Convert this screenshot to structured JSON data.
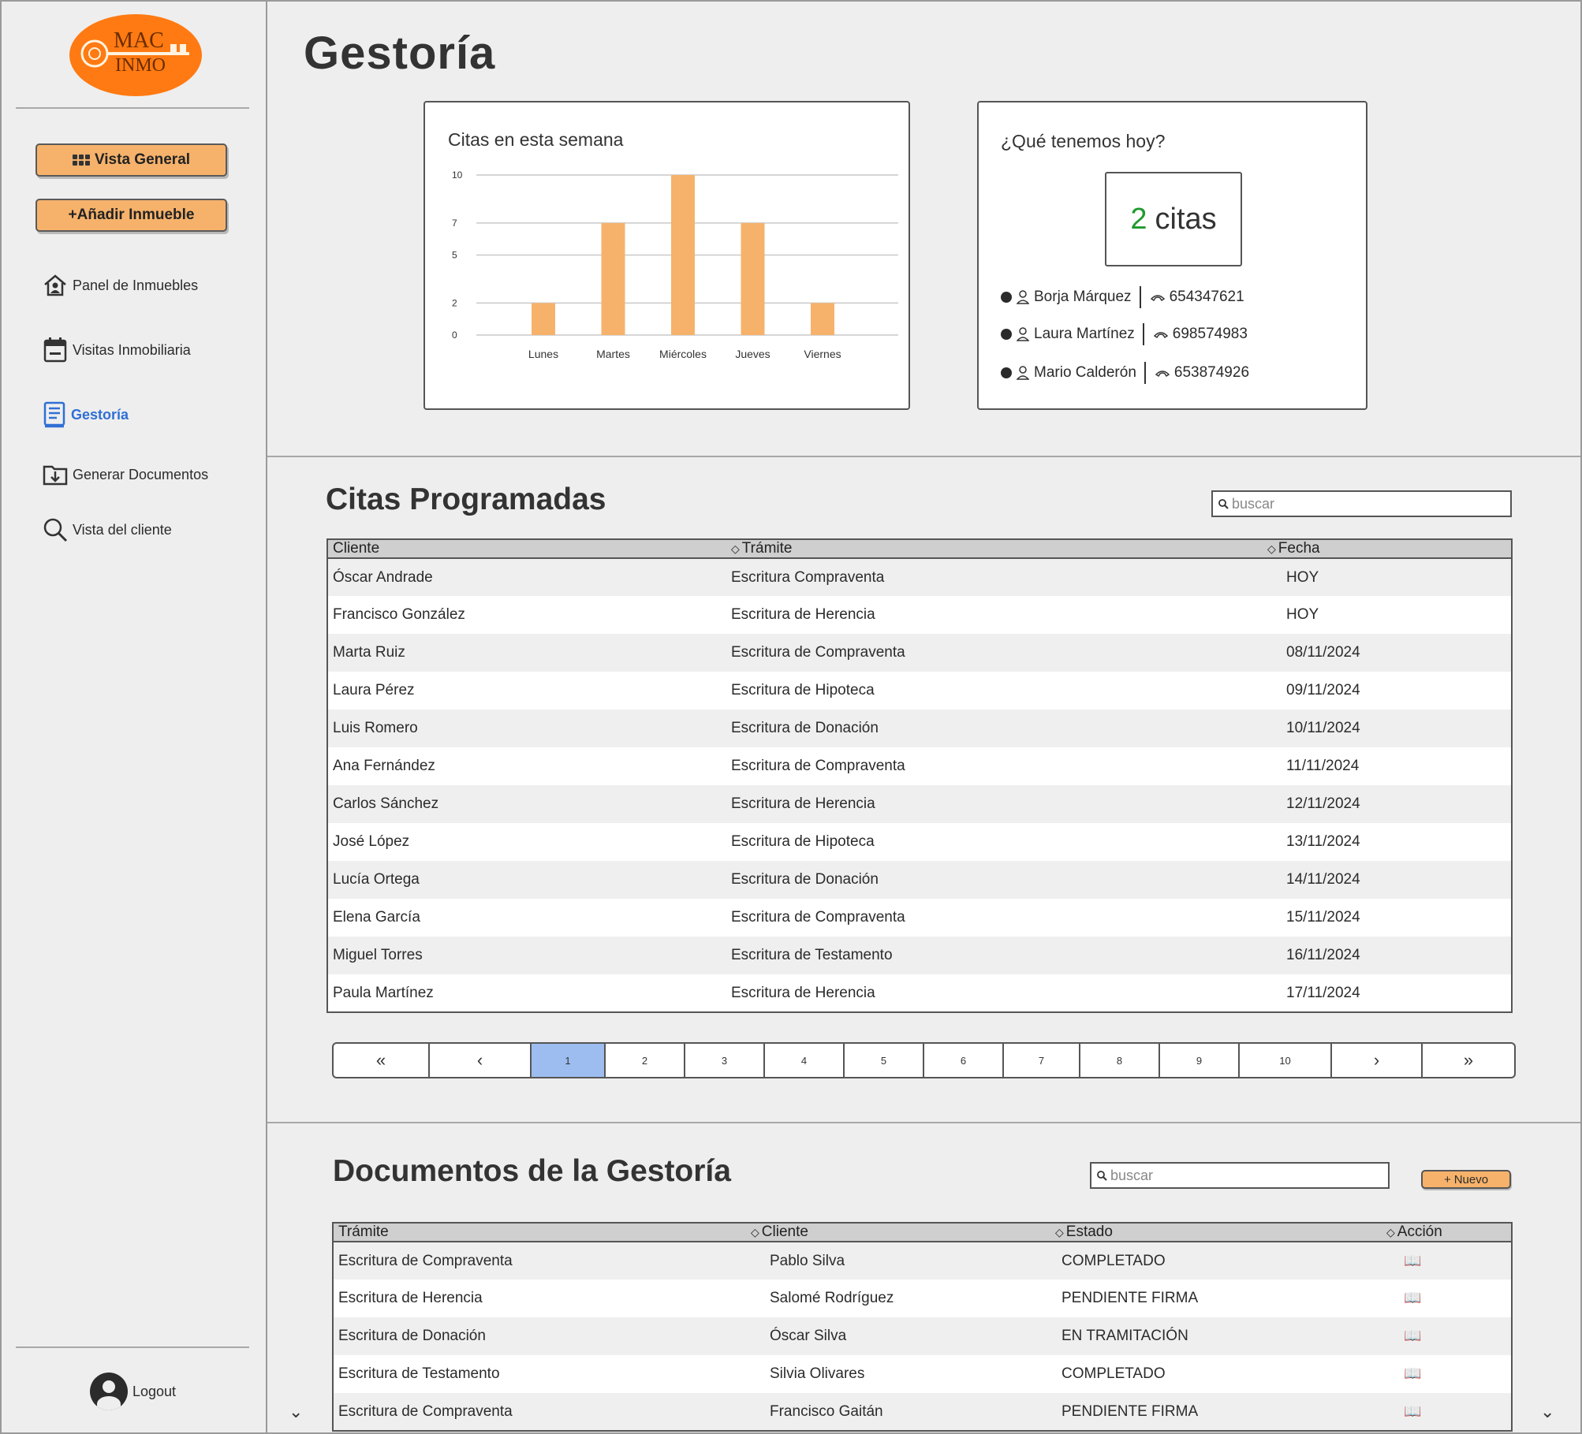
{
  "brand": {
    "line1": "MAC",
    "line2": "INMO",
    "logo_color": "#ff7a12"
  },
  "sidebar": {
    "primary_buttons": [
      {
        "label": "Vista General",
        "icon": "grid-icon"
      },
      {
        "label": "+Añadir Inmueble",
        "icon": ""
      }
    ],
    "items": [
      {
        "label": "Panel de Inmuebles",
        "icon": "house-user-icon",
        "active": false
      },
      {
        "label": "Visitas Inmobiliaria",
        "icon": "calendar-icon",
        "active": false
      },
      {
        "label": "Gestoría",
        "icon": "document-icon",
        "active": true
      },
      {
        "label": "Generar Documentos",
        "icon": "folder-download-icon",
        "active": false
      },
      {
        "label": "Vista del cliente",
        "icon": "search-icon",
        "active": false
      }
    ],
    "logout_label": "Logout"
  },
  "page": {
    "title": "Gestoría"
  },
  "weekly_card": {
    "title": "Citas en esta semana"
  },
  "chart_data": {
    "type": "bar",
    "title": "Citas en esta semana",
    "categories": [
      "Lunes",
      "Martes",
      "Miércoles",
      "Jueves",
      "Viernes"
    ],
    "values": [
      2,
      7,
      10,
      7,
      2
    ],
    "yticks": [
      0,
      2,
      5,
      7,
      10
    ],
    "ylim": [
      0,
      10
    ],
    "grid": true,
    "color": "#f6b26b"
  },
  "today_card": {
    "title": "¿Qué tenemos hoy?",
    "count": "2",
    "count_unit": "citas",
    "count_color": "#1f9a2e",
    "contacts": [
      {
        "name": "Borja Márquez",
        "phone": "654347621"
      },
      {
        "name": "Laura Martínez",
        "phone": "698574983"
      },
      {
        "name": "Mario Calderón",
        "phone": "653874926"
      }
    ]
  },
  "citas": {
    "title": "Citas Programadas",
    "search_placeholder": "buscar",
    "columns": [
      "Cliente",
      "Trámite",
      "Fecha"
    ],
    "rows": [
      [
        "Óscar Andrade",
        "Escritura Compraventa",
        "HOY"
      ],
      [
        "Francisco González",
        "Escritura de Herencia",
        "HOY"
      ],
      [
        "Marta Ruiz",
        "Escritura de Compraventa",
        "08/11/2024"
      ],
      [
        "Laura Pérez",
        "Escritura de Hipoteca",
        "09/11/2024"
      ],
      [
        "Luis Romero",
        "Escritura de Donación",
        "10/11/2024"
      ],
      [
        "Ana Fernández",
        "Escritura de Compraventa",
        "11/11/2024"
      ],
      [
        "Carlos Sánchez",
        "Escritura de Herencia",
        "12/11/2024"
      ],
      [
        "José López",
        "Escritura de Hipoteca",
        "13/11/2024"
      ],
      [
        "Lucía Ortega",
        "Escritura de Donación",
        "14/11/2024"
      ],
      [
        "Elena García",
        "Escritura de Compraventa",
        "15/11/2024"
      ],
      [
        "Miguel Torres",
        "Escritura de Testamento",
        "16/11/2024"
      ],
      [
        "Paula Martínez",
        "Escritura de Herencia",
        "17/11/2024"
      ]
    ],
    "pagination": {
      "first": "«",
      "prev": "‹",
      "next": "›",
      "last": "»",
      "pages": [
        "1",
        "2",
        "3",
        "4",
        "5",
        "6",
        "7",
        "8",
        "9",
        "10"
      ],
      "current": "1",
      "current_color": "#9dbdf0"
    }
  },
  "documentos": {
    "title": "Documentos de la Gestoría",
    "search_placeholder": "buscar",
    "new_label": "Nuevo",
    "columns": [
      "Trámite",
      "Cliente",
      "Estado",
      "Acción"
    ],
    "rows": [
      [
        "Escritura de Compraventa",
        "Pablo Silva",
        "COMPLETADO"
      ],
      [
        "Escritura de Herencia",
        "Salomé Rodríguez",
        "PENDIENTE FIRMA"
      ],
      [
        "Escritura de Donación",
        "Óscar Silva",
        "EN TRAMITACIÓN"
      ],
      [
        "Escritura de Testamento",
        "Silvia Olivares",
        "COMPLETADO"
      ],
      [
        "Escritura de Compraventa",
        "Francisco Gaitán",
        "PENDIENTE FIRMA"
      ]
    ],
    "action_icon": "book-icon"
  },
  "accent": {
    "orange": "#f6b26b",
    "blue_active": "#2f6fd6"
  }
}
